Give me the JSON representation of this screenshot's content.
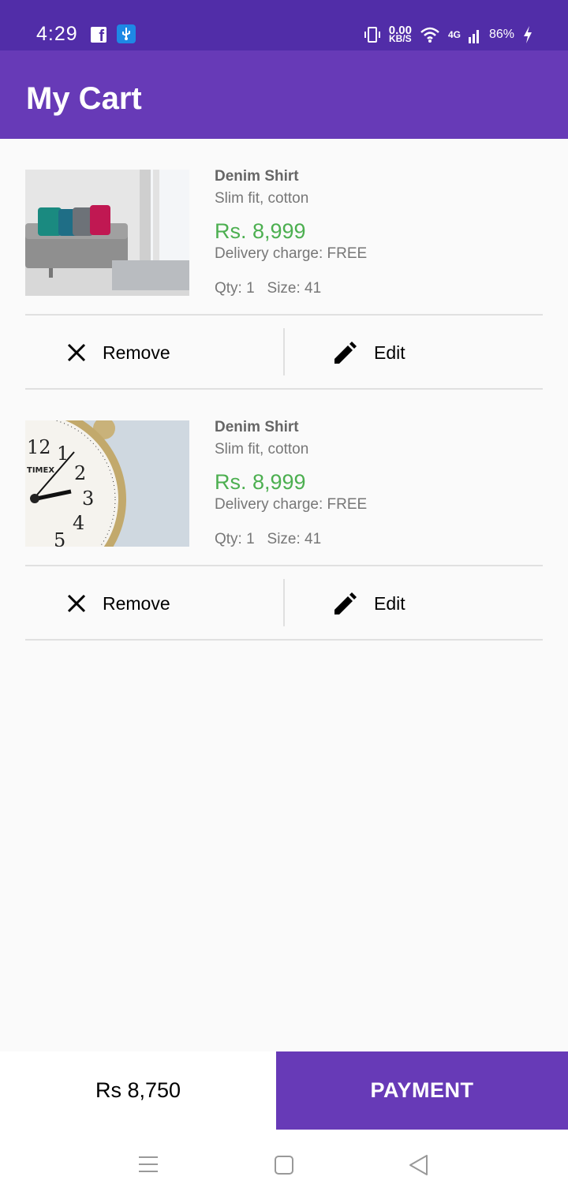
{
  "status_bar": {
    "time": "4:29",
    "data_rate": "0.00",
    "data_unit": "KB/S",
    "network": "4G",
    "battery": "86%",
    "icons": [
      "facebook-icon",
      "usb-icon",
      "vibrate-icon",
      "wifi-icon",
      "signal-icon",
      "charging-icon"
    ]
  },
  "app_bar": {
    "title": "My Cart"
  },
  "cart_items": [
    {
      "name": "Denim Shirt",
      "description": "Slim fit, cotton",
      "price": "Rs. 8,999",
      "delivery": "Delivery charge: FREE",
      "meta": "Qty: 1   Size: 41",
      "image": "sofa-photo",
      "remove_label": "Remove",
      "edit_label": "Edit"
    },
    {
      "name": "Denim Shirt",
      "description": "Slim fit, cotton",
      "price": "Rs. 8,999",
      "delivery": "Delivery charge: FREE",
      "meta": "Qty: 1   Size: 41",
      "image": "alarm-clock-photo",
      "remove_label": "Remove",
      "edit_label": "Edit"
    }
  ],
  "checkout": {
    "total": "Rs 8,750",
    "payment_label": "PAYMENT"
  },
  "colors": {
    "status_bar": "#512da8",
    "primary": "#673ab7",
    "price": "#4caf50"
  },
  "nav_bar": {
    "icons": [
      "menu-icon",
      "home-icon",
      "back-icon"
    ]
  }
}
